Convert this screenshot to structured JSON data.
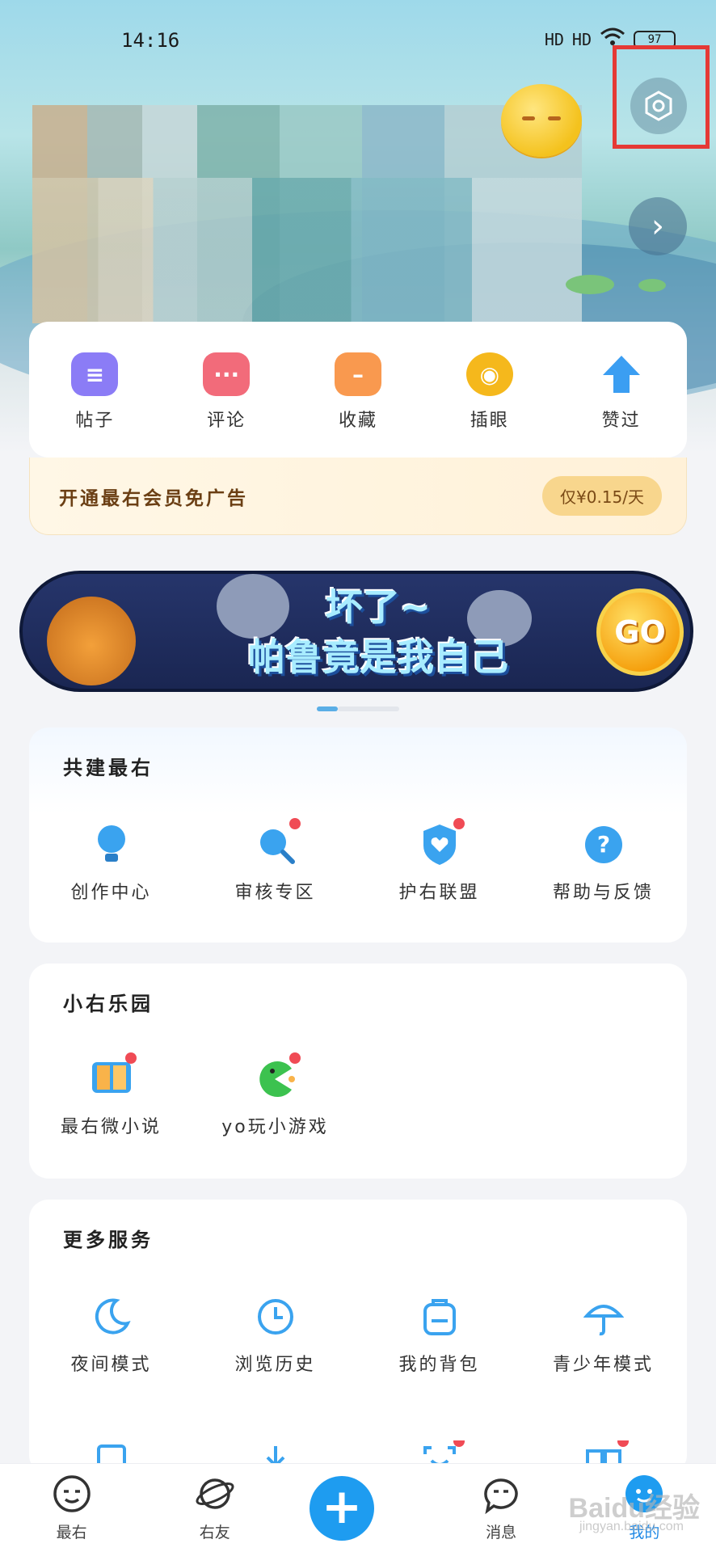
{
  "status_bar": {
    "time": "14:16",
    "network_1": "HD",
    "network_2": "HD",
    "battery": "97"
  },
  "quick_actions": [
    {
      "label": "帖子",
      "color": "#8b7cf6",
      "icon": "post-icon"
    },
    {
      "label": "评论",
      "color": "#f26b7a",
      "icon": "comment-icon"
    },
    {
      "label": "收藏",
      "color": "#f9994f",
      "icon": "folder-icon"
    },
    {
      "label": "插眼",
      "color": "#f5b81c",
      "icon": "eye-icon"
    },
    {
      "label": "赞过",
      "color": "#3b9ef2",
      "icon": "upvote-icon"
    }
  ],
  "vip": {
    "text": "开通最右会员免广告",
    "price": "仅¥0.15/天"
  },
  "banner": {
    "title_line1": "坏了~",
    "title_line2": "帕鲁竟是我自己",
    "go": "GO"
  },
  "section_build": {
    "title": "共建最右",
    "items": [
      {
        "label": "创作中心",
        "icon": "bulb-icon",
        "badge": false
      },
      {
        "label": "审核专区",
        "icon": "search-review-icon",
        "badge": true
      },
      {
        "label": "护右联盟",
        "icon": "shield-heart-icon",
        "badge": true
      },
      {
        "label": "帮助与反馈",
        "icon": "help-icon",
        "badge": false
      }
    ]
  },
  "section_fun": {
    "title": "小右乐园",
    "items": [
      {
        "label": "最右微小说",
        "icon": "book-icon",
        "badge": true
      },
      {
        "label": "yo玩小游戏",
        "icon": "pacman-icon",
        "badge": true
      }
    ]
  },
  "section_more": {
    "title": "更多服务",
    "items": [
      {
        "label": "夜间模式",
        "icon": "moon-icon"
      },
      {
        "label": "浏览历史",
        "icon": "clock-icon"
      },
      {
        "label": "我的背包",
        "icon": "backpack-icon"
      },
      {
        "label": "青少年模式",
        "icon": "umbrella-icon"
      }
    ]
  },
  "bottom_nav": [
    {
      "label": "最右",
      "icon": "home-face-icon"
    },
    {
      "label": "右友",
      "icon": "planet-icon"
    },
    {
      "label": "",
      "icon": "plus-icon"
    },
    {
      "label": "消息",
      "icon": "message-icon"
    },
    {
      "label": "我的",
      "icon": "profile-icon"
    }
  ],
  "watermark": {
    "brand": "Baidu经验",
    "url": "jingyan.baidu.com"
  },
  "accent_color": "#1e9cf0"
}
